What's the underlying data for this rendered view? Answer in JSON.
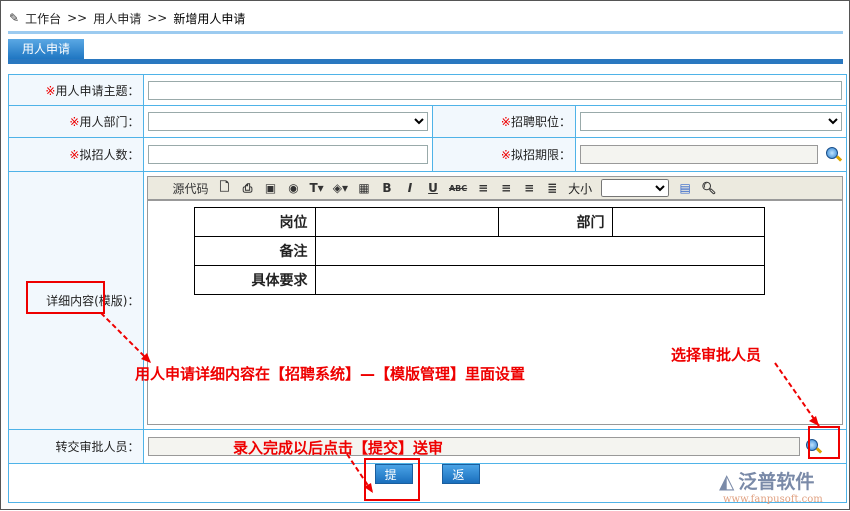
{
  "breadcrumb": {
    "items": [
      "工作台",
      ">>",
      "用人申请",
      ">>",
      "新增用人申请"
    ]
  },
  "tab": "用人申请",
  "form": {
    "subject_label": "用人申请主题：",
    "dept_label": "用人部门：",
    "position_label": "招聘职位：",
    "count_label": "拟招人数：",
    "deadline_label": "拟招期限：",
    "detail_label": "详细内容(模版)：",
    "approver_label": "转交审批人员：",
    "required_mark": "※"
  },
  "toolbar": {
    "source": "源代码",
    "bold": "B",
    "italic": "I",
    "underline": "U",
    "strike": "ABC",
    "size": "大小"
  },
  "template": {
    "r1": [
      "岗位",
      "部门"
    ],
    "r2": "备注",
    "r3": "具体要求"
  },
  "buttons": {
    "submit": "提 交",
    "back": "返 回"
  },
  "annotations": {
    "detail": "用人申请详细内容在【招聘系统】—【模版管理】里面设置",
    "approver": "选择审批人员",
    "submit": "录入完成以后点击【提交】送审"
  },
  "logo": {
    "name": "泛普软件",
    "url": "www.fanpusoft.com"
  }
}
